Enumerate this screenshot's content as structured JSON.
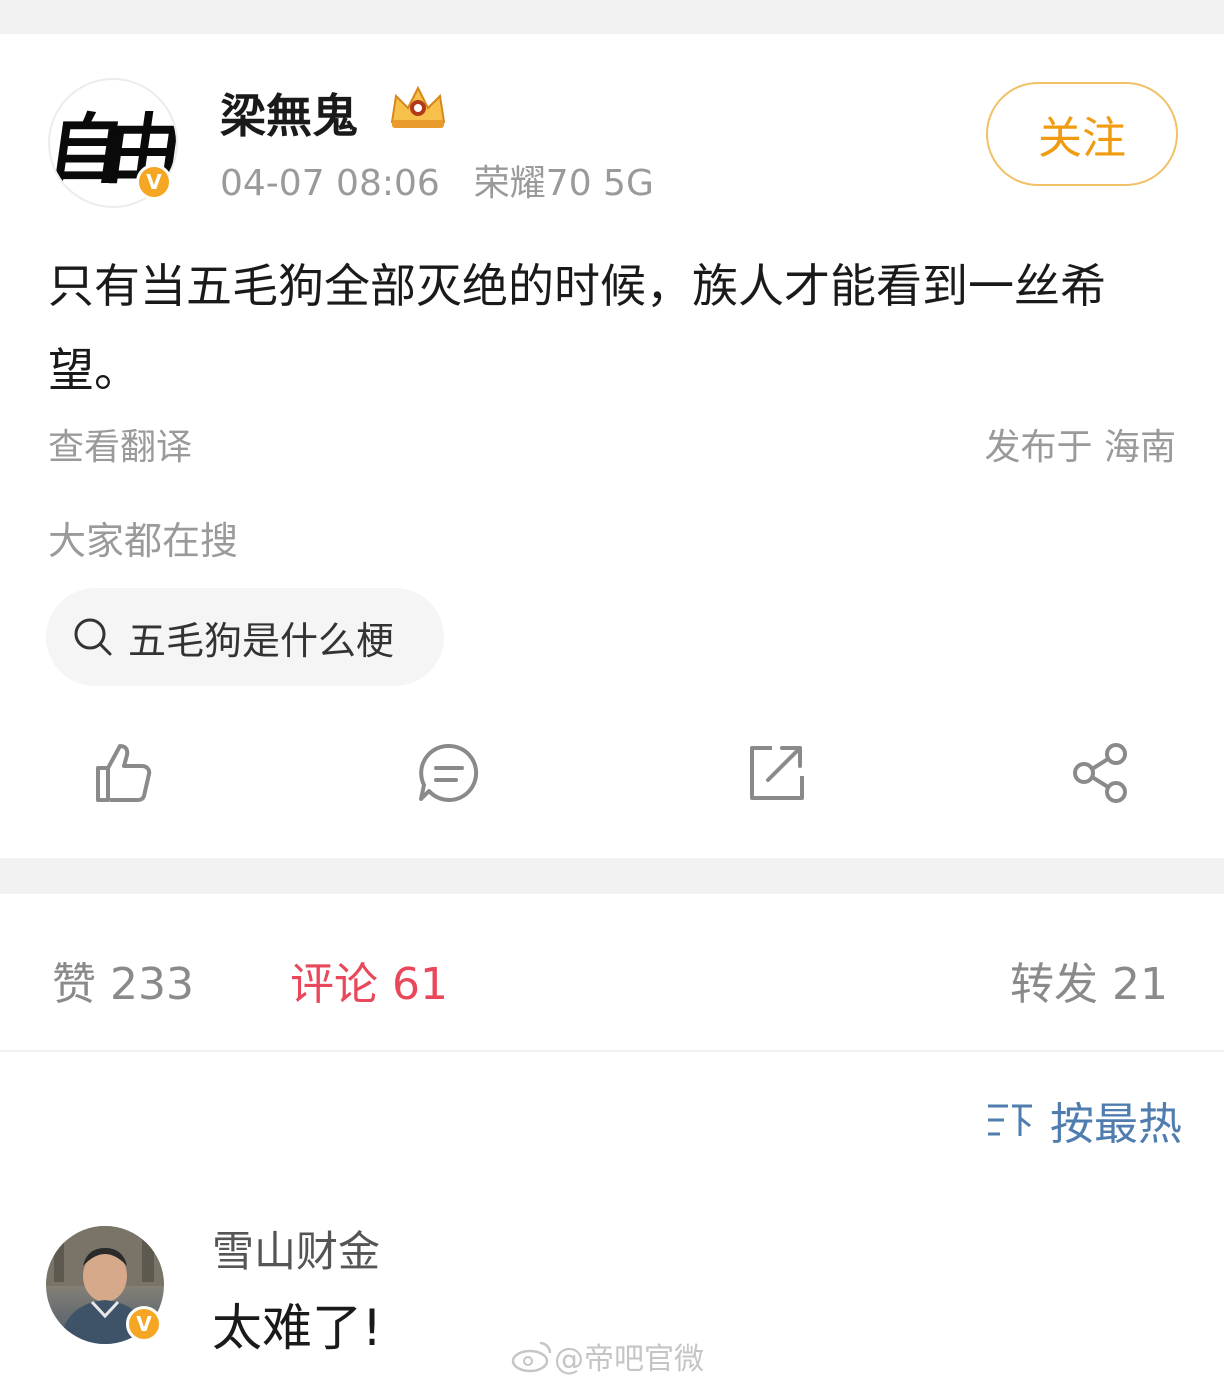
{
  "post": {
    "author": "梁無鬼",
    "avatar_text": "自由",
    "verified_badge": "V",
    "badge_icon": "crown-badge-icon",
    "time": "04-07 08:06",
    "device": "荣耀70 5G",
    "follow_label": "关注",
    "content": "只有当五毛狗全部灭绝的时候，族人才能看到一丝希望。",
    "translate_label": "查看翻译",
    "location": "发布于 海南",
    "search_section_label": "大家都在搜",
    "search_chip_text": "五毛狗是什么梗"
  },
  "actions": [
    {
      "icon": "like-icon"
    },
    {
      "icon": "comment-icon"
    },
    {
      "icon": "repost-icon"
    },
    {
      "icon": "share-icon"
    }
  ],
  "stats": {
    "likes": "赞 233",
    "comments": "评论 61",
    "reposts": "转发 21"
  },
  "sort": {
    "icon": "sort-icon",
    "label": "按最热"
  },
  "comments": [
    {
      "user": "雪山财金",
      "badge": "V",
      "text": "太难了!"
    }
  ],
  "watermark": "@帝吧官微",
  "colors": {
    "follow": "#f09b10",
    "active_tab": "#e8485a",
    "sort": "#507daf",
    "verified": "#f5a623"
  }
}
